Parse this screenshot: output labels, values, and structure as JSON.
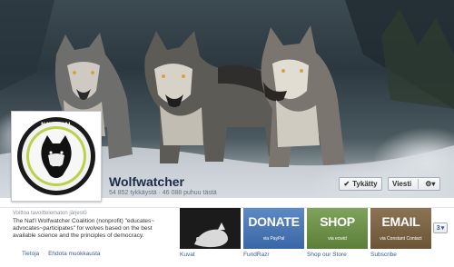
{
  "page": {
    "name": "Wolfwatcher",
    "stats": "54 852 tykkäystä · 46 088 puhuu tästä"
  },
  "profile": {
    "logo_alt": "National Wolfwatcher Coalition logo",
    "logo_text_top": "NATIONAL",
    "logo_text_bottom": "WOLFWATCHER COALITION"
  },
  "actions": {
    "like_label": "Tykätty",
    "message_label": "Viesti"
  },
  "about": {
    "category": "Voittoa tavoittelematon järjestö",
    "description": "The Nat'l Wolfwatcher Coalition (nonprofit) \"educates~ advocates~participates\" for wolves based on the best available science and the principles of democracy.",
    "link_info": "Tietoja",
    "link_edit": "Ehdota muokkausta"
  },
  "apps": [
    {
      "label": "Kuvat",
      "big": "",
      "small": ""
    },
    {
      "label": "FundRazr",
      "big": "DONATE",
      "small": "via PayPal"
    },
    {
      "label": "Shop our Store",
      "big": "SHOP",
      "small": "via ecwid"
    },
    {
      "label": "Subscribe",
      "big": "EMAIL",
      "small": "via Constant Contact"
    }
  ],
  "more": {
    "count": "3"
  },
  "icons": {
    "like": "check-icon",
    "settings": "gear-icon",
    "more": "chevron-down-icon"
  },
  "colors": {
    "link": "#3b5998",
    "donate": "#4a78b5",
    "shop": "#6c9148",
    "email": "#7b6446"
  }
}
